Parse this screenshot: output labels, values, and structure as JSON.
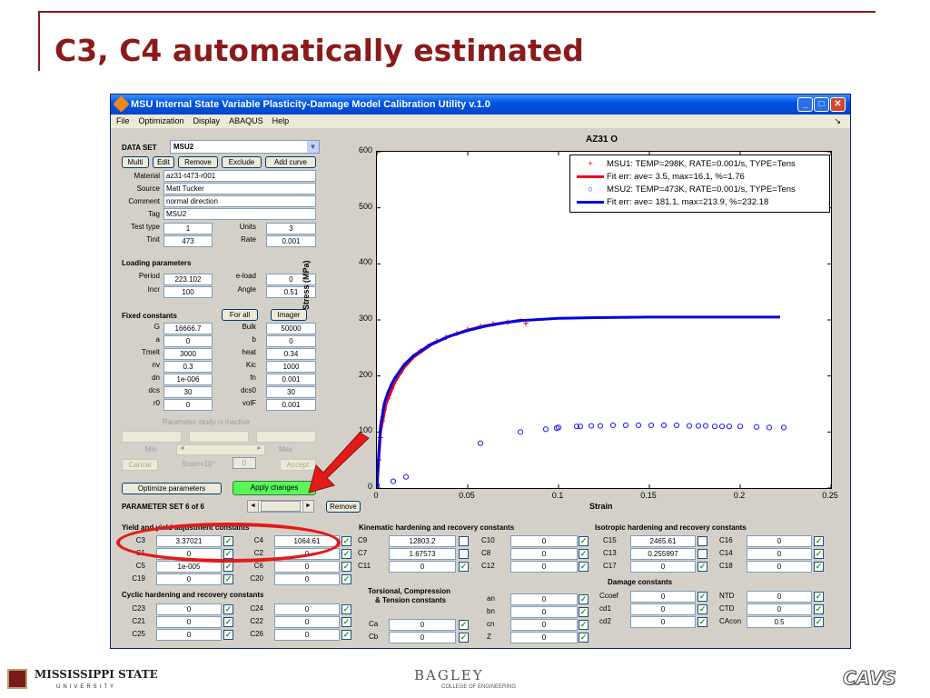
{
  "slide": {
    "title": "C3, C4 automatically estimated",
    "footer_left": "MISSISSIPPI STATE",
    "footer_left_sub": "UNIVERSITY",
    "footer_center": "BAGLEY",
    "footer_center_sub": "COLLEGE OF ENGINEERING",
    "footer_right": "CAVS"
  },
  "window": {
    "title": "MSU Internal State Variable Plasticity-Damage Model Calibration Utility v.1.0",
    "menu": [
      "File",
      "Optimization",
      "Display",
      "ABAQUS",
      "Help"
    ]
  },
  "dataset": {
    "label": "DATA SET",
    "selected": "MSU2",
    "buttons": [
      "Multi",
      "Edit",
      "Remove",
      "Exclude",
      "Add curve"
    ],
    "material_label": "Material",
    "material": "az31-t473-r001",
    "source_label": "Source",
    "source": "Matt Tucker",
    "comment_label": "Comment",
    "comment": "normal direction",
    "tag_label": "Tag",
    "tag": "MSU2",
    "testtype_label": "Test type",
    "testtype": "1",
    "units_label": "Units",
    "units": "3",
    "tinit_label": "Tinit",
    "tinit": "473",
    "rate_label": "Rate",
    "rate": "0.001"
  },
  "loading": {
    "title": "Loading parameters",
    "period_label": "Period",
    "period": "223.102",
    "eload_label": "e-load",
    "eload": "0",
    "incr_label": "Incr",
    "incr": "100",
    "angle_label": "Angle",
    "angle": "0.51"
  },
  "fixed": {
    "title": "Fixed constants",
    "forall": "For all",
    "imager": "Imager",
    "rows": [
      {
        "l1": "G",
        "v1": "16666.7",
        "l2": "Bulk",
        "v2": "50000"
      },
      {
        "l1": "a",
        "v1": "0",
        "l2": "b",
        "v2": "0"
      },
      {
        "l1": "Tmelt",
        "v1": "3000",
        "l2": "heat",
        "v2": "0.34"
      },
      {
        "l1": "nv",
        "v1": "0.3",
        "l2": "Kic",
        "v2": "1000"
      },
      {
        "l1": "dn",
        "v1": "1e-006",
        "l2": "fn",
        "v2": "0.001"
      },
      {
        "l1": "dcs",
        "v1": "30",
        "l2": "dcs0",
        "v2": "30"
      },
      {
        "l1": "r0",
        "v1": "0",
        "l2": "volF",
        "v2": "0.001"
      }
    ]
  },
  "study": {
    "status": "Parameter study is inactive",
    "min": "Min",
    "max": "Max",
    "cancel": "Cancel",
    "scale": "Scale=10^",
    "scale_val": "0",
    "accept": "Accept"
  },
  "actions": {
    "optimize": "Optimize parameters",
    "apply": "Apply changes",
    "paramset": "PARAMETER SET 6 of 6",
    "remove": "Remove"
  },
  "yield": {
    "title": "Yield and yield adjustment constants",
    "rows": [
      {
        "l1": "C3",
        "v1": "3.37021",
        "l2": "C4",
        "v2": "1064.61"
      },
      {
        "l1": "C1",
        "v1": "0",
        "l2": "C2",
        "v2": "0"
      },
      {
        "l1": "C5",
        "v1": "1e-005",
        "l2": "C6",
        "v2": "0"
      },
      {
        "l1": "C19",
        "v1": "0",
        "l2": "C20",
        "v2": "0"
      }
    ]
  },
  "cyclic": {
    "title": "Cyclic hardening and recovery constants",
    "rows": [
      {
        "l1": "C23",
        "v1": "0",
        "l2": "C24",
        "v2": "0"
      },
      {
        "l1": "C21",
        "v1": "0",
        "l2": "C22",
        "v2": "0"
      },
      {
        "l1": "C25",
        "v1": "0",
        "l2": "C26",
        "v2": "0"
      }
    ]
  },
  "kinematic": {
    "title": "Kinematic hardening and recovery constants",
    "rows": [
      {
        "l1": "C9",
        "v1": "12803.2",
        "c1": false,
        "l2": "C10",
        "v2": "0",
        "c2": true
      },
      {
        "l1": "C7",
        "v1": "1.67573",
        "c1": false,
        "l2": "C8",
        "v2": "0",
        "c2": true
      },
      {
        "l1": "C11",
        "v1": "0",
        "c1": true,
        "l2": "C12",
        "v2": "0",
        "c2": true
      }
    ]
  },
  "torsional": {
    "title1": "Torsional, Compression",
    "title2": "& Tension constants",
    "rows": [
      {
        "l1": "Ca",
        "v1": "0",
        "l2": "an",
        "v2": "0"
      },
      {
        "l1": "Cb",
        "v1": "0",
        "l2": "bn",
        "v2": "0"
      }
    ],
    "extra": [
      {
        "l": "cn",
        "v": "0"
      },
      {
        "l": "Z",
        "v": "0"
      }
    ]
  },
  "isotropic": {
    "title": "Isotropic hardening and recovery constants",
    "rows": [
      {
        "l1": "C15",
        "v1": "2465.61",
        "c1": false,
        "l2": "C16",
        "v2": "0"
      },
      {
        "l1": "C13",
        "v1": "0.255997",
        "c1": false,
        "l2": "C14",
        "v2": "0"
      },
      {
        "l1": "C17",
        "v1": "0",
        "c1": true,
        "l2": "C18",
        "v2": "0"
      }
    ]
  },
  "damage": {
    "title": "Damage constants",
    "rows": [
      {
        "l1": "Ccoef",
        "v1": "0",
        "l2": "NTD",
        "v2": "0"
      },
      {
        "l1": "cd1",
        "v1": "0",
        "l2": "CTD",
        "v2": "0"
      },
      {
        "l1": "cd2",
        "v1": "0",
        "l2": "CAcon",
        "v2": "0.5"
      }
    ]
  },
  "chart_data": {
    "type": "scatter",
    "title": "AZ31 O",
    "xlabel": "Strain",
    "ylabel": "Stress (MPa)",
    "xlim": [
      0,
      0.25
    ],
    "ylim": [
      0,
      600
    ],
    "xticks": [
      "0",
      "0.05",
      "0.1",
      "0.15",
      "0.2",
      "0.25"
    ],
    "yticks": [
      "0",
      "100",
      "200",
      "300",
      "400",
      "500",
      "600"
    ],
    "legend_position": "top-right",
    "series": [
      {
        "name": "MSU1: TEMP=298K, RATE=0.001/s, TYPE=Tens",
        "marker": "plus",
        "color": "#e8001c",
        "x": [
          0.001,
          0.002,
          0.003,
          0.004,
          0.006,
          0.008,
          0.01,
          0.013,
          0.016,
          0.02,
          0.024,
          0.028,
          0.033,
          0.038,
          0.044,
          0.05,
          0.057,
          0.064,
          0.072,
          0.082
        ],
        "y": [
          50,
          90,
          120,
          140,
          160,
          178,
          192,
          206,
          222,
          234,
          245,
          253,
          262,
          269,
          276,
          283,
          289,
          293,
          296,
          294
        ]
      },
      {
        "name": "Fit err: ave= 3.5, max=16.1, %=1.76",
        "line": true,
        "color": "#e8001c",
        "x": [
          0,
          0.002,
          0.005,
          0.01,
          0.015,
          0.02,
          0.03,
          0.04,
          0.05,
          0.06,
          0.07,
          0.08
        ],
        "y": [
          0,
          100,
          150,
          190,
          215,
          233,
          256,
          271,
          282,
          290,
          295,
          300
        ]
      },
      {
        "name": "MSU2: TEMP=473K, RATE=0.001/s, TYPE=Tens",
        "marker": "circle",
        "color": "#1a1aff",
        "x": [
          0.0,
          0.009,
          0.016,
          0.057,
          0.079,
          0.093,
          0.099,
          0.1,
          0.11,
          0.112,
          0.118,
          0.123,
          0.13,
          0.137,
          0.144,
          0.151,
          0.158,
          0.165,
          0.172,
          0.177,
          0.181,
          0.186,
          0.19,
          0.194,
          0.2,
          0.209,
          0.216,
          0.224
        ],
        "y": [
          5,
          12,
          20,
          80,
          100,
          105,
          107,
          108,
          110,
          110,
          111,
          111,
          112,
          112,
          112,
          112,
          112,
          112,
          111,
          111,
          111,
          110,
          110,
          110,
          110,
          109,
          108,
          108
        ]
      },
      {
        "name": "Fit err: ave= 181.1, max=213.9, %=232.18",
        "line": true,
        "color": "#0000e0",
        "x": [
          0,
          0.001,
          0.002,
          0.004,
          0.006,
          0.008,
          0.01,
          0.015,
          0.02,
          0.03,
          0.04,
          0.05,
          0.06,
          0.07,
          0.08,
          0.1,
          0.12,
          0.15,
          0.18,
          0.2,
          0.222
        ],
        "y": [
          0,
          60,
          110,
          150,
          170,
          185,
          197,
          220,
          236,
          257,
          271,
          281,
          289,
          295,
          299,
          303,
          304,
          305,
          305,
          305,
          305
        ]
      }
    ]
  },
  "annotation": {
    "arrow_color": "#e21a1a",
    "ellipse_color": "#e21a1a"
  }
}
